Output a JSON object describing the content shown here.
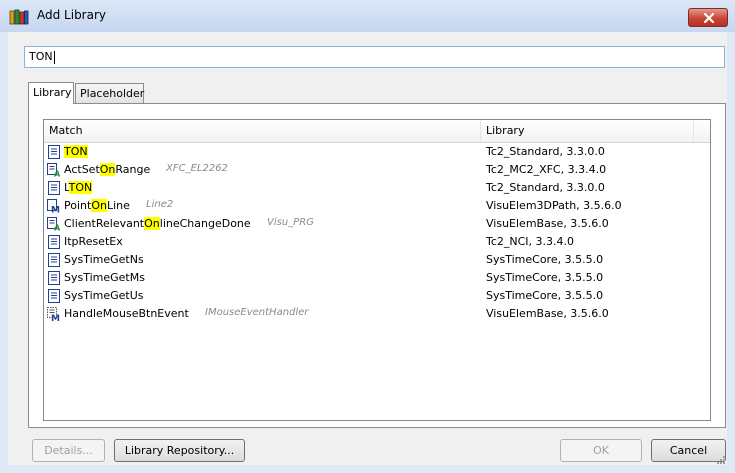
{
  "window": {
    "title": "Add Library",
    "close_label": "Close"
  },
  "search": {
    "value": "TON"
  },
  "tabs": [
    {
      "label": "Library",
      "active": true
    },
    {
      "label": "Placeholder",
      "active": false
    }
  ],
  "list": {
    "columns": {
      "match": "Match",
      "library": "Library"
    },
    "rows": [
      {
        "icon": "function-block-icon",
        "pre": "",
        "hl": "TON",
        "post": "",
        "ns": "",
        "library": "Tc2_Standard, 3.3.0.0"
      },
      {
        "icon": "action-icon",
        "pre": "ActSet",
        "hl": "On",
        "post": "Range",
        "ns": "XFC_EL2262",
        "library": "Tc2_MC2_XFC, 3.3.4.0"
      },
      {
        "icon": "function-block-icon",
        "pre": "L",
        "hl": "TON",
        "post": "",
        "ns": "",
        "library": "Tc2_Standard, 3.3.0.0"
      },
      {
        "icon": "method-icon",
        "pre": "Point",
        "hl": "On",
        "post": "Line",
        "ns": "Line2",
        "library": "VisuElem3DPath, 3.5.6.0"
      },
      {
        "icon": "action-icon",
        "pre": "ClientRelevant",
        "hl": "On",
        "post": "lineChangeDone",
        "ns": "Visu_PRG",
        "library": "VisuElemBase, 3.5.6.0"
      },
      {
        "icon": "function-block-icon",
        "pre": "ItpResetEx",
        "hl": "",
        "post": "",
        "ns": "",
        "library": "Tc2_NCI, 3.3.4.0"
      },
      {
        "icon": "function-block-icon",
        "pre": "SysTimeGetNs",
        "hl": "",
        "post": "",
        "ns": "",
        "library": "SysTimeCore, 3.5.5.0"
      },
      {
        "icon": "function-block-icon",
        "pre": "SysTimeGetMs",
        "hl": "",
        "post": "",
        "ns": "",
        "library": "SysTimeCore, 3.5.5.0"
      },
      {
        "icon": "function-block-icon",
        "pre": "SysTimeGetUs",
        "hl": "",
        "post": "",
        "ns": "",
        "library": "SysTimeCore, 3.5.5.0"
      },
      {
        "icon": "interface-method-icon",
        "pre": "HandleMouseBtnEvent",
        "hl": "",
        "post": "",
        "ns": "IMouseEventHandler",
        "library": "VisuElemBase, 3.5.6.0"
      }
    ]
  },
  "buttons": {
    "details": "Details...",
    "repository": "Library Repository...",
    "ok": "OK",
    "cancel": "Cancel"
  }
}
